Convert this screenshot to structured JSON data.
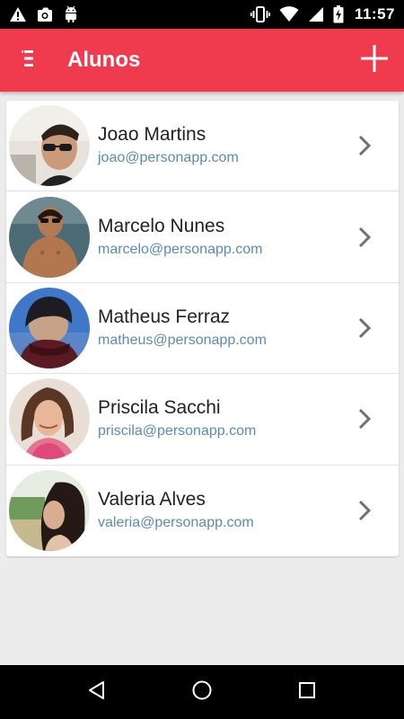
{
  "status_bar": {
    "time": "11:57",
    "left_icons": [
      "warning-icon",
      "photo-icon",
      "android-icon"
    ],
    "right_icons": [
      "vibrate-icon",
      "wifi-icon",
      "signal-icon",
      "battery-icon"
    ]
  },
  "app_bar": {
    "title": "Alunos",
    "menu_icon": "menu-icon",
    "add_icon": "plus-icon",
    "color": "#ef3b4d"
  },
  "students": [
    {
      "name": "Joao Martins",
      "email": "joao@personapp.com"
    },
    {
      "name": "Marcelo Nunes",
      "email": "marcelo@personapp.com"
    },
    {
      "name": "Matheus Ferraz",
      "email": "matheus@personapp.com"
    },
    {
      "name": "Priscila Sacchi",
      "email": "priscila@personapp.com"
    },
    {
      "name": "Valeria Alves",
      "email": "valeria@personapp.com"
    }
  ],
  "nav_bar": {
    "buttons": [
      "back-icon",
      "home-icon",
      "recents-icon"
    ]
  },
  "colors": {
    "accent": "#ef3b4d",
    "email_text": "#5b8bb0",
    "background": "#ececec"
  }
}
